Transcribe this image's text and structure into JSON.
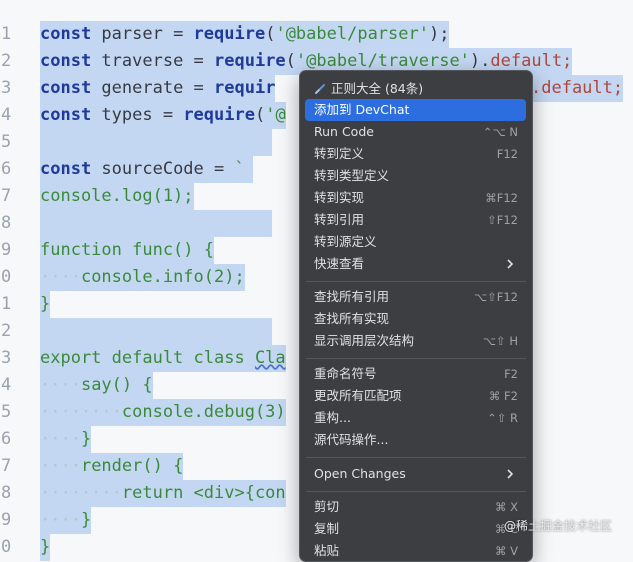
{
  "editor": {
    "line_numbers": [
      "1",
      "2",
      "3",
      "4",
      "5",
      "6",
      "7",
      "8",
      "9",
      "0",
      "1",
      "2",
      "3",
      "4",
      "5",
      "6",
      "7",
      "8",
      "9",
      "0"
    ],
    "code": {
      "l1": {
        "kw": "const",
        "rest1": " parser = ",
        "req": "require",
        "p1": "(",
        "str": "'@babel/parser'",
        "p2": ");"
      },
      "l2": {
        "kw": "const",
        "rest1": " traverse = ",
        "req": "require",
        "p1": "(",
        "str": "'@babel/traverse'",
        "p2": ").",
        "tail": "default;"
      },
      "l3": {
        "kw": "const",
        "rest1": " generate = ",
        "req": "requir",
        "tail": ".default;"
      },
      "l4": {
        "kw": "const",
        "rest1": " types = ",
        "req": "require",
        "p1": "(",
        "str": "'@"
      },
      "l6": {
        "kw": "const",
        "rest1": " sourceCode = ",
        "str": "`"
      },
      "l7": {
        "text": "console.log(1);"
      },
      "l9": {
        "text": "function func() {"
      },
      "l10": {
        "ws": "····",
        "text": "console.info(2);"
      },
      "l11": {
        "text": "}"
      },
      "l13": {
        "text": "export default class ",
        "cls": "Cla"
      },
      "l14": {
        "ws": "····",
        "text": "say() {"
      },
      "l15": {
        "ws": "········",
        "text": "console.debug(3)"
      },
      "l16": {
        "ws": "····",
        "text": "}"
      },
      "l17": {
        "ws": "····",
        "text": "render() {"
      },
      "l18": {
        "ws": "········",
        "text": "return <div>{con"
      },
      "l19": {
        "ws": "····",
        "text": "}"
      },
      "l20": {
        "text": "}"
      }
    }
  },
  "context_menu": {
    "header": {
      "label": "正则大全 (84条)",
      "icon": "brush-icon"
    },
    "items": [
      {
        "label": "添加到 DevChat",
        "shortcut": "",
        "active": true
      },
      {
        "label": "Run Code",
        "shortcut": "⌃⌥ N"
      },
      {
        "label": "转到定义",
        "shortcut": "F12"
      },
      {
        "label": "转到类型定义",
        "shortcut": ""
      },
      {
        "label": "转到实现",
        "shortcut": "⌘F12"
      },
      {
        "label": "转到引用",
        "shortcut": "⇧F12"
      },
      {
        "label": "转到源定义",
        "shortcut": ""
      },
      {
        "label": "快速查看",
        "shortcut": "",
        "submenu": true
      },
      {
        "label": "查找所有引用",
        "shortcut": "⌥⇧F12"
      },
      {
        "label": "查找所有实现",
        "shortcut": ""
      },
      {
        "label": "显示调用层次结构",
        "shortcut": "⌥⇧ H"
      },
      {
        "label": "重命名符号",
        "shortcut": "F2"
      },
      {
        "label": "更改所有匹配项",
        "shortcut": "⌘ F2"
      },
      {
        "label": "重构...",
        "shortcut": "⌃⇧ R"
      },
      {
        "label": "源代码操作...",
        "shortcut": ""
      },
      {
        "label": "Open Changes",
        "shortcut": "",
        "submenu": true
      },
      {
        "label": "剪切",
        "shortcut": "⌘ X"
      },
      {
        "label": "复制",
        "shortcut": "⌘ C"
      },
      {
        "label": "粘贴",
        "shortcut": "⌘ V"
      }
    ]
  },
  "watermark": "@稀土掘金技术社区",
  "colors": {
    "selection": "#c3d7f3",
    "keyword": "#1f3a9a",
    "string": "#3a8a3a",
    "menu_bg": "#3c3e42",
    "menu_active": "#2c6ee0"
  }
}
